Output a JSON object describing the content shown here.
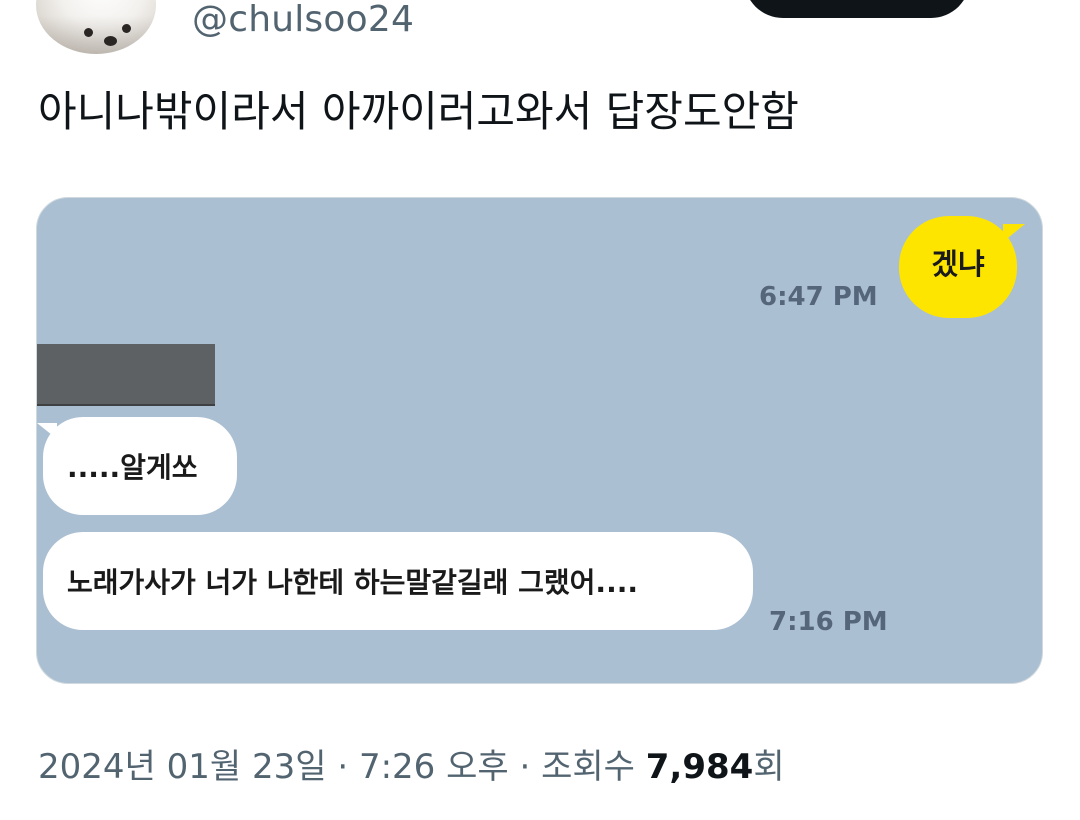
{
  "header": {
    "handle": "@chulsoo24"
  },
  "tweet": {
    "text": "아니나밖이라서 아까이러고와서 답장도안함"
  },
  "chat": {
    "messages": [
      {
        "side": "right",
        "text": "겠냐",
        "time": "6:47 PM",
        "color": "#fee500"
      },
      {
        "side": "left",
        "text": ".....알게쏘",
        "color": "#ffffff"
      },
      {
        "side": "left",
        "text": "노래가사가 너가 나한테 하는말같길래 그랬어....",
        "time": "7:16 PM",
        "color": "#ffffff"
      }
    ],
    "background": "#abbfd2"
  },
  "meta": {
    "date": "2024년 01월 23일",
    "sep1": " · ",
    "time": "7:26 오후",
    "sep2": " · ",
    "views_label": "조회수 ",
    "views_count": "7,984",
    "views_suffix": "회"
  }
}
